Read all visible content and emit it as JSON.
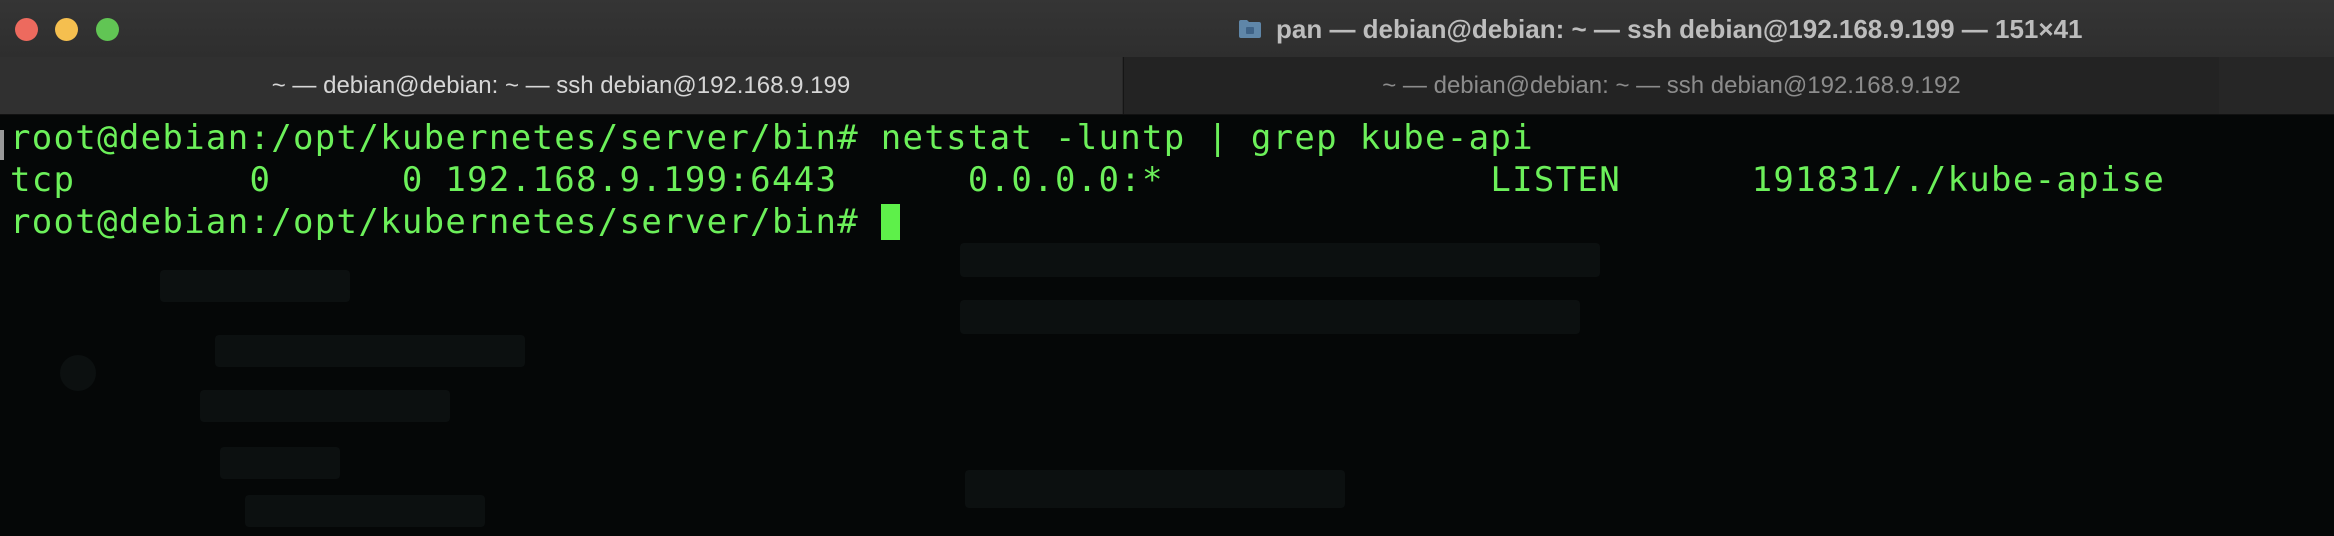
{
  "window": {
    "title": "pan — debian@debian: ~ — ssh debian@192.168.9.199 — 151×41"
  },
  "tabs": [
    {
      "label": "~ — debian@debian: ~ — ssh debian@192.168.9.199",
      "active": true
    },
    {
      "label": "~ — debian@debian: ~ — ssh debian@192.168.9.192",
      "active": false
    }
  ],
  "terminal": {
    "lines": [
      "root@debian:/opt/kubernetes/server/bin# netstat -luntp | grep kube-api",
      "tcp        0      0 192.168.9.199:6443      0.0.0.0:*               LISTEN      191831/./kube-apise",
      "root@debian:/opt/kubernetes/server/bin# "
    ],
    "text_color": "#6cf05a",
    "background": "#050707"
  },
  "icons": {
    "close": "close-icon",
    "minimize": "minimize-icon",
    "maximize": "maximize-icon",
    "folder": "folder-icon"
  }
}
